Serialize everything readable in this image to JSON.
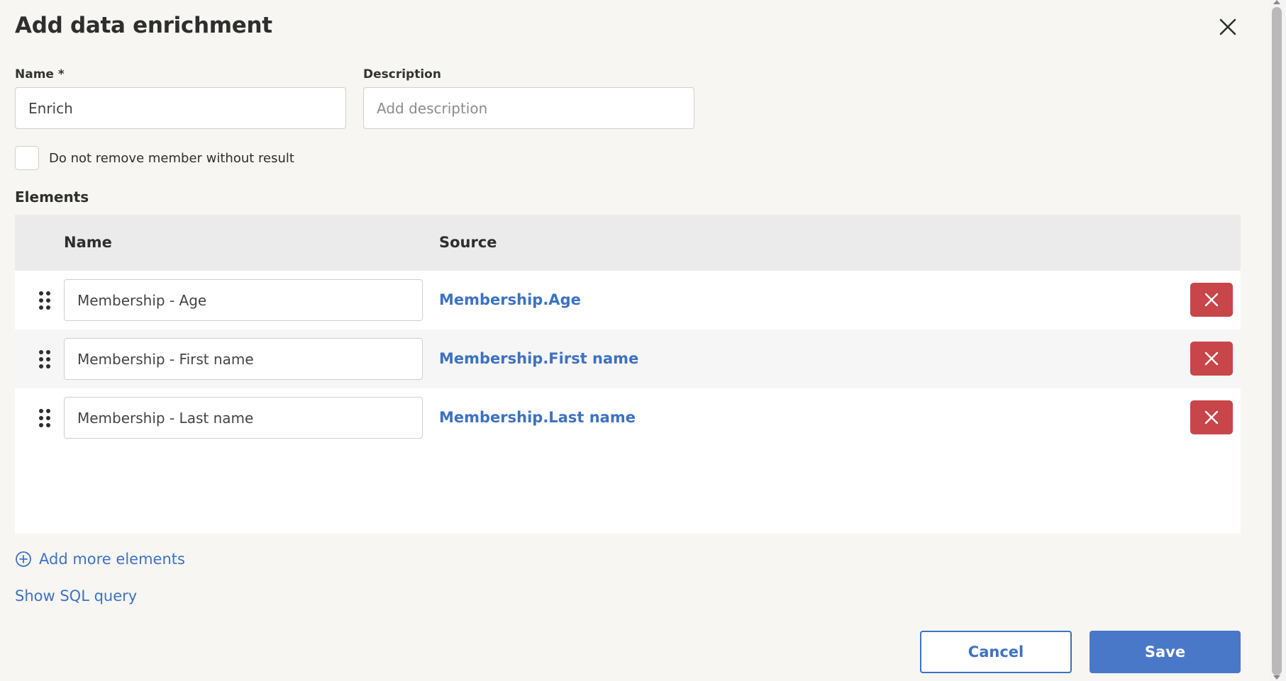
{
  "dialog": {
    "title": "Add data enrichment",
    "close_icon": "close-icon"
  },
  "form": {
    "name_label": "Name *",
    "name_value": "Enrich",
    "description_label": "Description",
    "description_placeholder": "Add description",
    "description_value": "",
    "checkbox_label": "Do not remove member without result",
    "checkbox_checked": false
  },
  "elements": {
    "section_title": "Elements",
    "columns": {
      "name": "Name",
      "source": "Source"
    },
    "rows": [
      {
        "name": "Membership - Age",
        "source": "Membership.Age"
      },
      {
        "name": "Membership - First name",
        "source": "Membership.First name"
      },
      {
        "name": "Membership - Last name",
        "source": "Membership.Last name"
      }
    ],
    "drag_icon": "drag-handle-icon",
    "remove_icon": "remove-icon"
  },
  "actions": {
    "add_more_label": "Add more elements",
    "add_more_icon": "plus-circle-icon",
    "show_sql_label": "Show SQL query",
    "cancel_label": "Cancel",
    "save_label": "Save"
  },
  "colors": {
    "accent": "#3d72c2",
    "primary_button": "#4a78c8",
    "danger": "#c8454a",
    "background": "#f7f6f3",
    "table_header": "#ebebeb"
  }
}
